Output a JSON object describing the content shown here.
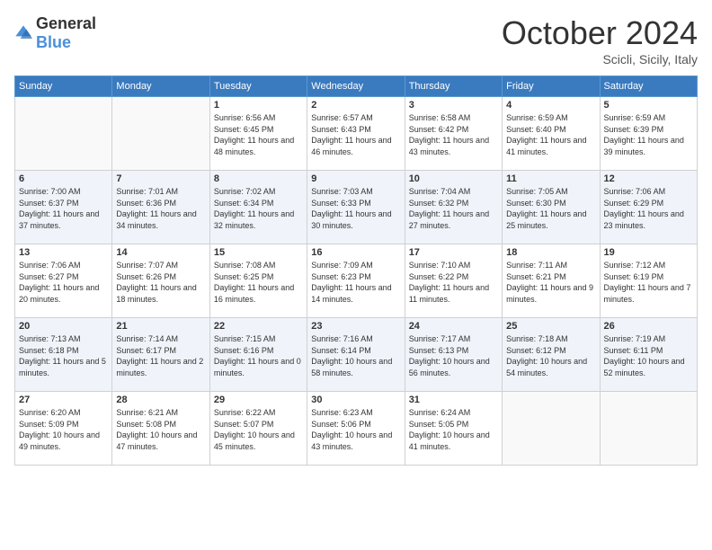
{
  "logo": {
    "general": "General",
    "blue": "Blue"
  },
  "header": {
    "month": "October 2024",
    "location": "Scicli, Sicily, Italy"
  },
  "weekdays": [
    "Sunday",
    "Monday",
    "Tuesday",
    "Wednesday",
    "Thursday",
    "Friday",
    "Saturday"
  ],
  "weeks": [
    [
      {
        "day": "",
        "info": ""
      },
      {
        "day": "",
        "info": ""
      },
      {
        "day": "1",
        "info": "Sunrise: 6:56 AM\nSunset: 6:45 PM\nDaylight: 11 hours and 48 minutes."
      },
      {
        "day": "2",
        "info": "Sunrise: 6:57 AM\nSunset: 6:43 PM\nDaylight: 11 hours and 46 minutes."
      },
      {
        "day": "3",
        "info": "Sunrise: 6:58 AM\nSunset: 6:42 PM\nDaylight: 11 hours and 43 minutes."
      },
      {
        "day": "4",
        "info": "Sunrise: 6:59 AM\nSunset: 6:40 PM\nDaylight: 11 hours and 41 minutes."
      },
      {
        "day": "5",
        "info": "Sunrise: 6:59 AM\nSunset: 6:39 PM\nDaylight: 11 hours and 39 minutes."
      }
    ],
    [
      {
        "day": "6",
        "info": "Sunrise: 7:00 AM\nSunset: 6:37 PM\nDaylight: 11 hours and 37 minutes."
      },
      {
        "day": "7",
        "info": "Sunrise: 7:01 AM\nSunset: 6:36 PM\nDaylight: 11 hours and 34 minutes."
      },
      {
        "day": "8",
        "info": "Sunrise: 7:02 AM\nSunset: 6:34 PM\nDaylight: 11 hours and 32 minutes."
      },
      {
        "day": "9",
        "info": "Sunrise: 7:03 AM\nSunset: 6:33 PM\nDaylight: 11 hours and 30 minutes."
      },
      {
        "day": "10",
        "info": "Sunrise: 7:04 AM\nSunset: 6:32 PM\nDaylight: 11 hours and 27 minutes."
      },
      {
        "day": "11",
        "info": "Sunrise: 7:05 AM\nSunset: 6:30 PM\nDaylight: 11 hours and 25 minutes."
      },
      {
        "day": "12",
        "info": "Sunrise: 7:06 AM\nSunset: 6:29 PM\nDaylight: 11 hours and 23 minutes."
      }
    ],
    [
      {
        "day": "13",
        "info": "Sunrise: 7:06 AM\nSunset: 6:27 PM\nDaylight: 11 hours and 20 minutes."
      },
      {
        "day": "14",
        "info": "Sunrise: 7:07 AM\nSunset: 6:26 PM\nDaylight: 11 hours and 18 minutes."
      },
      {
        "day": "15",
        "info": "Sunrise: 7:08 AM\nSunset: 6:25 PM\nDaylight: 11 hours and 16 minutes."
      },
      {
        "day": "16",
        "info": "Sunrise: 7:09 AM\nSunset: 6:23 PM\nDaylight: 11 hours and 14 minutes."
      },
      {
        "day": "17",
        "info": "Sunrise: 7:10 AM\nSunset: 6:22 PM\nDaylight: 11 hours and 11 minutes."
      },
      {
        "day": "18",
        "info": "Sunrise: 7:11 AM\nSunset: 6:21 PM\nDaylight: 11 hours and 9 minutes."
      },
      {
        "day": "19",
        "info": "Sunrise: 7:12 AM\nSunset: 6:19 PM\nDaylight: 11 hours and 7 minutes."
      }
    ],
    [
      {
        "day": "20",
        "info": "Sunrise: 7:13 AM\nSunset: 6:18 PM\nDaylight: 11 hours and 5 minutes."
      },
      {
        "day": "21",
        "info": "Sunrise: 7:14 AM\nSunset: 6:17 PM\nDaylight: 11 hours and 2 minutes."
      },
      {
        "day": "22",
        "info": "Sunrise: 7:15 AM\nSunset: 6:16 PM\nDaylight: 11 hours and 0 minutes."
      },
      {
        "day": "23",
        "info": "Sunrise: 7:16 AM\nSunset: 6:14 PM\nDaylight: 10 hours and 58 minutes."
      },
      {
        "day": "24",
        "info": "Sunrise: 7:17 AM\nSunset: 6:13 PM\nDaylight: 10 hours and 56 minutes."
      },
      {
        "day": "25",
        "info": "Sunrise: 7:18 AM\nSunset: 6:12 PM\nDaylight: 10 hours and 54 minutes."
      },
      {
        "day": "26",
        "info": "Sunrise: 7:19 AM\nSunset: 6:11 PM\nDaylight: 10 hours and 52 minutes."
      }
    ],
    [
      {
        "day": "27",
        "info": "Sunrise: 6:20 AM\nSunset: 5:09 PM\nDaylight: 10 hours and 49 minutes."
      },
      {
        "day": "28",
        "info": "Sunrise: 6:21 AM\nSunset: 5:08 PM\nDaylight: 10 hours and 47 minutes."
      },
      {
        "day": "29",
        "info": "Sunrise: 6:22 AM\nSunset: 5:07 PM\nDaylight: 10 hours and 45 minutes."
      },
      {
        "day": "30",
        "info": "Sunrise: 6:23 AM\nSunset: 5:06 PM\nDaylight: 10 hours and 43 minutes."
      },
      {
        "day": "31",
        "info": "Sunrise: 6:24 AM\nSunset: 5:05 PM\nDaylight: 10 hours and 41 minutes."
      },
      {
        "day": "",
        "info": ""
      },
      {
        "day": "",
        "info": ""
      }
    ]
  ]
}
